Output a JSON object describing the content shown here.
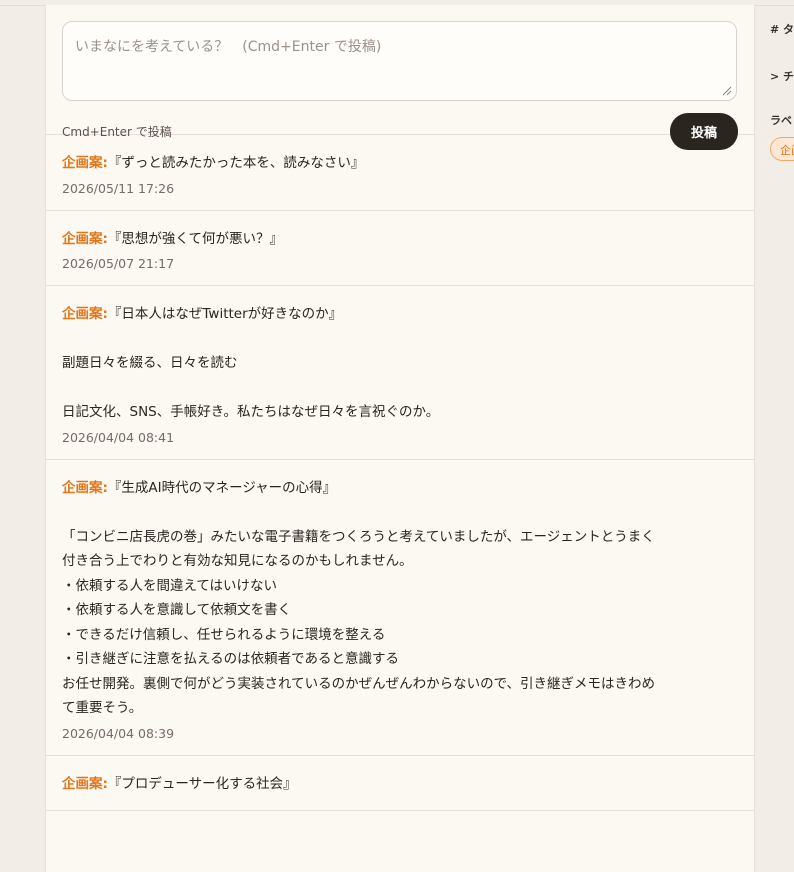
{
  "composer": {
    "placeholder": "いまなにを考えている？　(Cmd+Enter で投稿)",
    "hint": "Cmd+Enter で投稿",
    "post_label": "投稿"
  },
  "posts": [
    {
      "label": "企画案:",
      "text": "『ずっと読みたかった本を、読みなさい』",
      "time": "2026/05/11 17:26"
    },
    {
      "label": "企画案:",
      "text": "『思想が強くて何が悪い？』",
      "time": "2026/05/07 21:17"
    },
    {
      "label": "企画案:",
      "text": "『日本人はなぜTwitterが好きなのか』\n\n副題日々を綴る、日々を読む\n\n日記文化、SNS、手帳好き。私たちはなぜ日々を言祝ぐのか。",
      "time": "2026/04/04 08:41"
    },
    {
      "label": "企画案:",
      "text": "『生成AI時代のマネージャーの心得』\n\n「コンビニ店長虎の巻」みたいな電子書籍をつくろうと考えていましたが、エージェントとうまく\n付き合う上でわりと有効な知見になるのかもしれません。\n・依頼する人を間違えてはいけない\n・依頼する人を意識して依頼文を書く\n・できるだけ信頼し、任せられるように環境を整える\n・引き継ぎに注意を払えるのは依頼者であると意識する\nお任せ開発。裏側で何がどう実装されているのかぜんぜんわからないので、引き継ぎメモはきわめ\nて重要そう。",
      "time": "2026/04/04 08:39"
    },
    {
      "label": "企画案:",
      "text": "『プロデューサー化する社会』",
      "time": ""
    }
  ],
  "sidebar": {
    "tags_heading": "# タ",
    "chat_heading": "> チ",
    "labels_heading": "ラベ",
    "chip_label": "企画"
  }
}
